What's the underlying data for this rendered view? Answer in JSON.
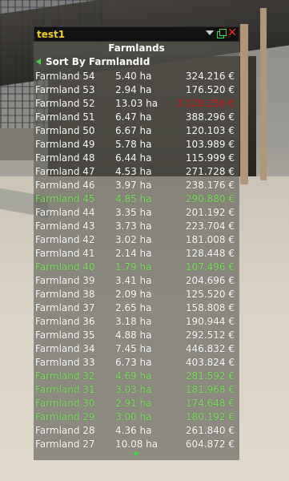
{
  "window": {
    "title": "test1"
  },
  "header": {
    "title": "Farmlands"
  },
  "sort": {
    "label": "Sort By FarmlandId"
  },
  "rows": [
    {
      "name": "Farmland 54",
      "area": "5.40 ha",
      "price": "324.216 €",
      "green": false,
      "red": false
    },
    {
      "name": "Farmland 53",
      "area": "2.94 ha",
      "price": "176.520 €",
      "green": false,
      "red": false
    },
    {
      "name": "Farmland 52",
      "area": "13.03 ha",
      "price": "3.128.256 €",
      "green": false,
      "red": true
    },
    {
      "name": "Farmland 51",
      "area": "6.47 ha",
      "price": "388.296 €",
      "green": false,
      "red": false
    },
    {
      "name": "Farmland 50",
      "area": "6.67 ha",
      "price": "120.103 €",
      "green": false,
      "red": false
    },
    {
      "name": "Farmland 49",
      "area": "5.78 ha",
      "price": "103.989 €",
      "green": false,
      "red": false
    },
    {
      "name": "Farmland 48",
      "area": "6.44 ha",
      "price": "115.999 €",
      "green": false,
      "red": false
    },
    {
      "name": "Farmland 47",
      "area": "4.53 ha",
      "price": "271.728 €",
      "green": false,
      "red": false
    },
    {
      "name": "Farmland 46",
      "area": "3.97 ha",
      "price": "238.176 €",
      "green": false,
      "red": false
    },
    {
      "name": "Farmland 45",
      "area": "4.85 ha",
      "price": "290.880 €",
      "green": true,
      "red": false
    },
    {
      "name": "Farmland 44",
      "area": "3.35 ha",
      "price": "201.192 €",
      "green": false,
      "red": false
    },
    {
      "name": "Farmland 43",
      "area": "3.73 ha",
      "price": "223.704 €",
      "green": false,
      "red": false
    },
    {
      "name": "Farmland 42",
      "area": "3.02 ha",
      "price": "181.008 €",
      "green": false,
      "red": false
    },
    {
      "name": "Farmland 41",
      "area": "2.14 ha",
      "price": "128.448 €",
      "green": false,
      "red": false
    },
    {
      "name": "Farmland 40",
      "area": "1.79 ha",
      "price": "107.496 €",
      "green": true,
      "red": false
    },
    {
      "name": "Farmland 39",
      "area": "3.41 ha",
      "price": "204.696 €",
      "green": false,
      "red": false
    },
    {
      "name": "Farmland 38",
      "area": "2.09 ha",
      "price": "125.520 €",
      "green": false,
      "red": false
    },
    {
      "name": "Farmland 37",
      "area": "2.65 ha",
      "price": "158.808 €",
      "green": false,
      "red": false
    },
    {
      "name": "Farmland 36",
      "area": "3.18 ha",
      "price": "190.944 €",
      "green": false,
      "red": false
    },
    {
      "name": "Farmland 35",
      "area": "4.88 ha",
      "price": "292.512 €",
      "green": false,
      "red": false
    },
    {
      "name": "Farmland 34",
      "area": "7.45 ha",
      "price": "446.832 €",
      "green": false,
      "red": false
    },
    {
      "name": "Farmland 33",
      "area": "6.73 ha",
      "price": "403.824 €",
      "green": false,
      "red": false
    },
    {
      "name": "Farmland 32",
      "area": "4.69 ha",
      "price": "281.592 €",
      "green": true,
      "red": false
    },
    {
      "name": "Farmland 31",
      "area": "3.03 ha",
      "price": "181.968 €",
      "green": true,
      "red": false
    },
    {
      "name": "Farmland 30",
      "area": "2.91 ha",
      "price": "174.648 €",
      "green": true,
      "red": false
    },
    {
      "name": "Farmland 29",
      "area": "3.00 ha",
      "price": "180.192 €",
      "green": true,
      "red": false
    },
    {
      "name": "Farmland 28",
      "area": "4.36 ha",
      "price": "261.840 €",
      "green": false,
      "red": false
    },
    {
      "name": "Farmland 27",
      "area": "10.08 ha",
      "price": "604.872 €",
      "green": false,
      "red": false
    }
  ],
  "colors": {
    "owned_green": "#7ce35e",
    "expensive_red": "#e11b1b",
    "title_yellow": "#f2d21a",
    "accent_green": "#3fd84a",
    "close_red": "#ff2626"
  },
  "icons": {
    "dropdown": "chevron-down-icon",
    "copy": "copy-icon",
    "close": "close-icon",
    "sort_prev": "arrow-left-icon",
    "scroll_more": "arrow-down-icon"
  }
}
